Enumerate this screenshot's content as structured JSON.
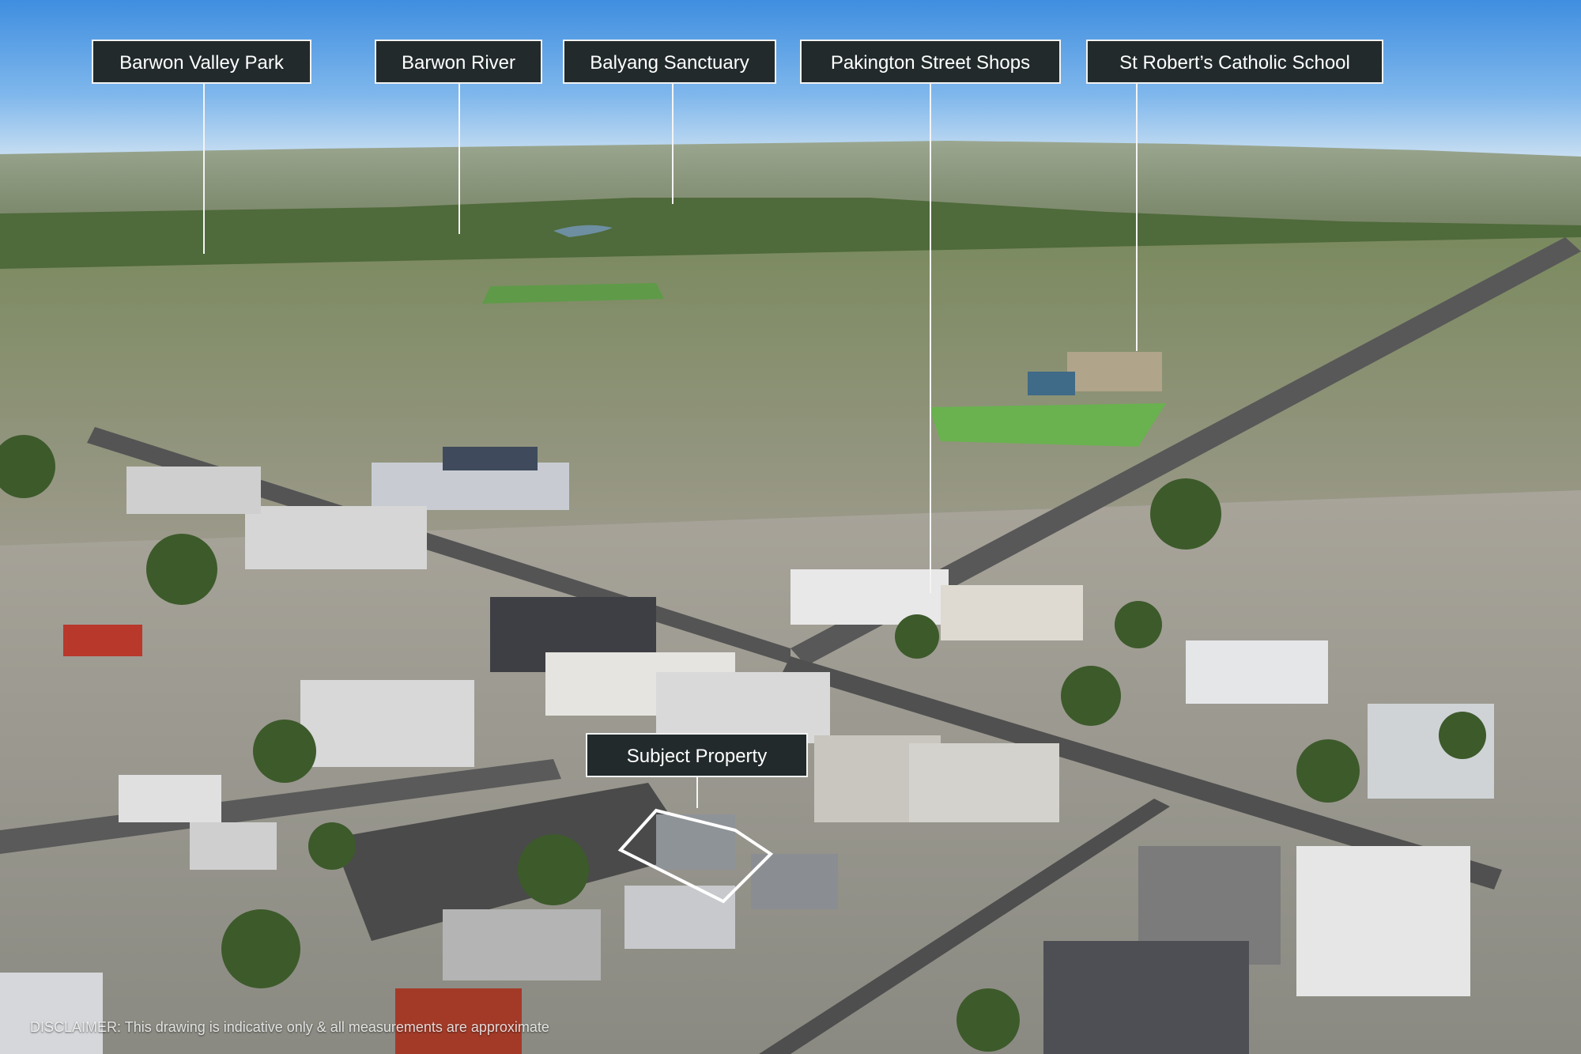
{
  "labels": {
    "barwon_valley_park": "Barwon Valley Park",
    "barwon_river": "Barwon River",
    "balyang_sanctuary": "Balyang Sanctuary",
    "pakington_street_shops": "Pakington Street Shops",
    "st_roberts_catholic_school": "St Robert’s Catholic School",
    "subject_property": "Subject Property"
  },
  "disclaimer": "DISCLAIMER: This drawing is indicative only & all measurements are approximate",
  "colors": {
    "label_background": "#222a2b",
    "label_text": "#ffffff",
    "leader_line": "#f4f4f4",
    "sky": "#5aa0e6"
  }
}
